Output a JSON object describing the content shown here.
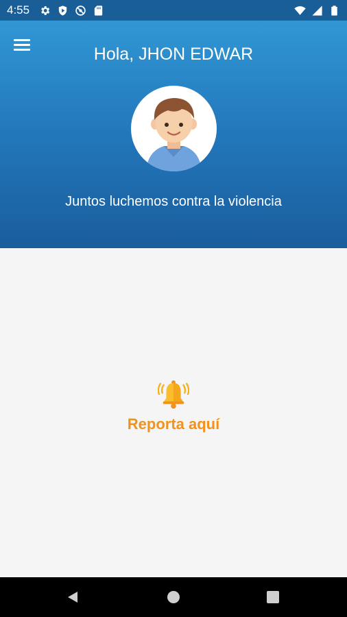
{
  "status_bar": {
    "time": "4:55",
    "left_icons": [
      "gear-icon",
      "shield-icon",
      "sync-icon",
      "sd-card-icon"
    ],
    "right_icons": [
      "wifi-icon",
      "signal-icon",
      "battery-icon"
    ]
  },
  "header": {
    "greeting": "Hola, JHON EDWAR",
    "slogan": "Juntos luchemos contra la violencia",
    "menu_icon": "hamburger-menu-icon",
    "avatar_icon": "boy-avatar-icon",
    "gradient_top": "#3197d4",
    "gradient_bottom": "#1a5d9c"
  },
  "main": {
    "report_label": "Reporta aquí",
    "report_icon": "bell-icon",
    "accent_color": "#f0921c"
  },
  "nav_bar": {
    "buttons": [
      "back-icon",
      "home-icon",
      "recents-icon"
    ]
  }
}
